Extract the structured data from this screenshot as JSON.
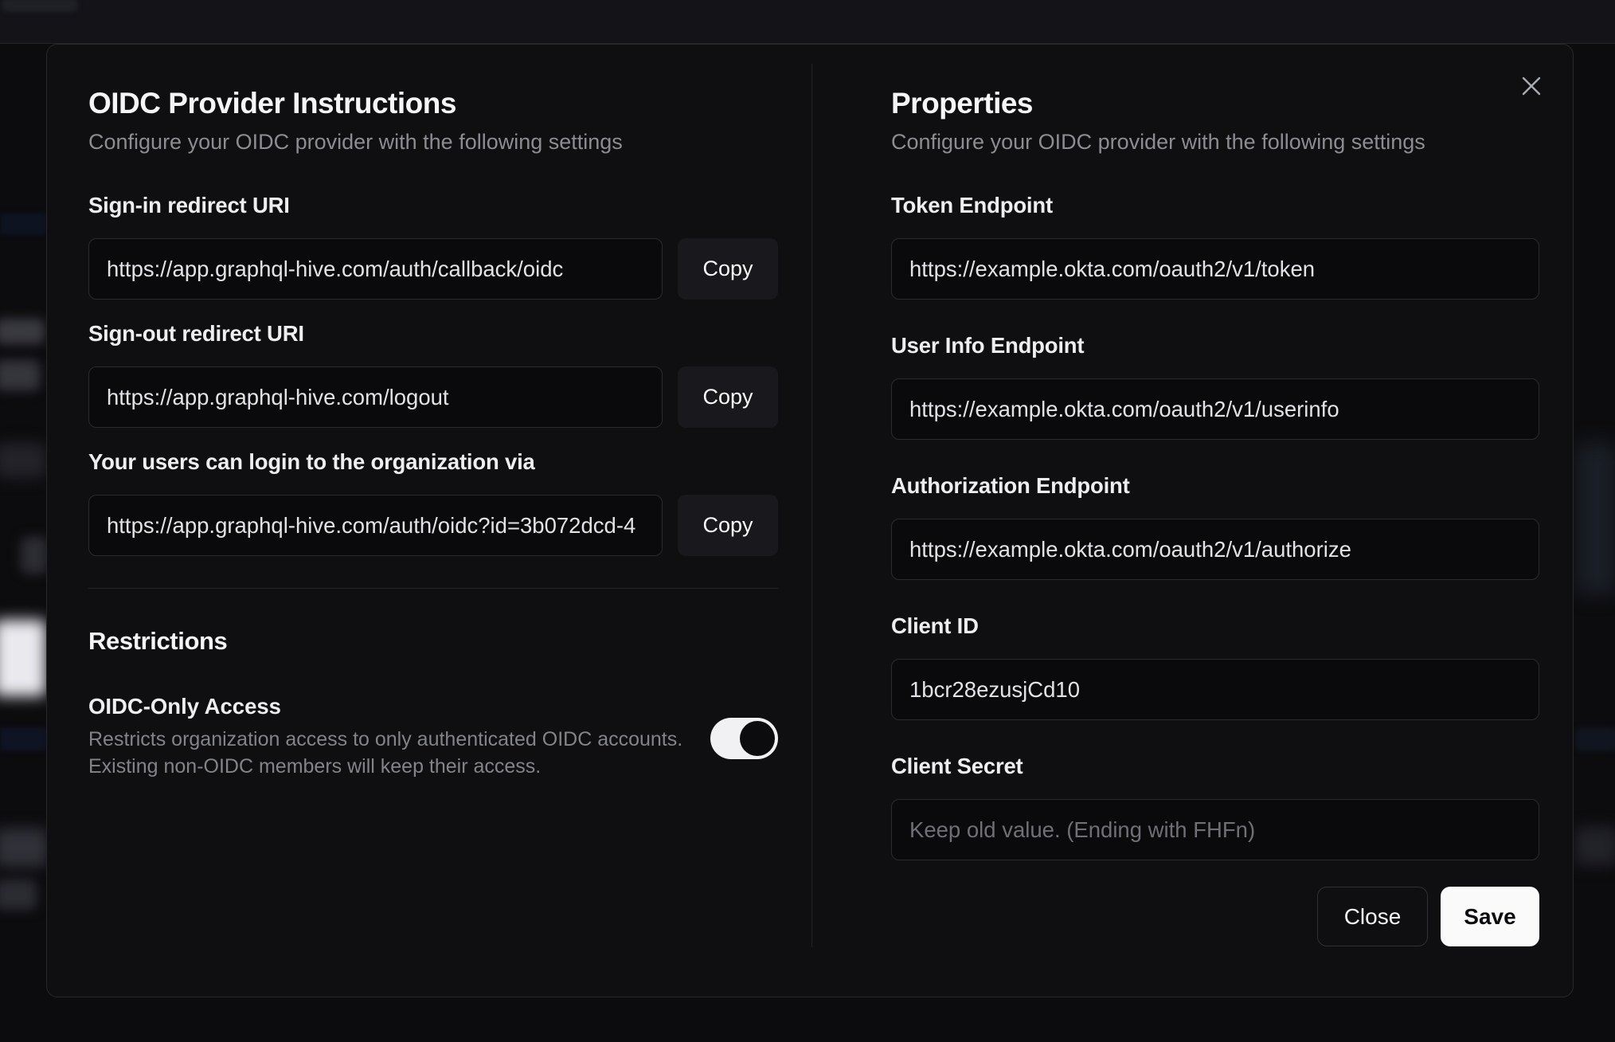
{
  "modal": {
    "left": {
      "title": "OIDC Provider Instructions",
      "subtitle": "Configure your OIDC provider with the following settings",
      "fields": [
        {
          "label": "Sign-in redirect URI",
          "value": "https://app.graphql-hive.com/auth/callback/oidc",
          "copy_label": "Copy"
        },
        {
          "label": "Sign-out redirect URI",
          "value": "https://app.graphql-hive.com/logout",
          "copy_label": "Copy"
        },
        {
          "label": "Your users can login to the organization via",
          "value": "https://app.graphql-hive.com/auth/oidc?id=3b072dcd-4",
          "copy_label": "Copy"
        }
      ],
      "restrictions": {
        "section_title": "Restrictions",
        "toggle_label": "OIDC-Only Access",
        "description_line1": "Restricts organization access to only authenticated OIDC accounts.",
        "description_line2": "Existing non-OIDC members will keep their access.",
        "toggle_state": "on"
      }
    },
    "right": {
      "title": "Properties",
      "subtitle": "Configure your OIDC provider with the following settings",
      "fields": [
        {
          "label": "Token Endpoint",
          "value": "https://example.okta.com/oauth2/v1/token"
        },
        {
          "label": "User Info Endpoint",
          "value": "https://example.okta.com/oauth2/v1/userinfo"
        },
        {
          "label": "Authorization Endpoint",
          "value": "https://example.okta.com/oauth2/v1/authorize"
        },
        {
          "label": "Client ID",
          "value": "1bcr28ezusjCd10"
        },
        {
          "label": "Client Secret",
          "value": "",
          "placeholder": "Keep old value. (Ending with FHFn)"
        }
      ],
      "close_label": "Close",
      "save_label": "Save"
    },
    "icons": {
      "close": "x-mark"
    },
    "colors": {
      "modal_bg": "#0f0f12",
      "save_button_bg": "#fafafa",
      "toggle_on_track": "#f1f1f3",
      "toggle_on_knob": "#0c0c0f"
    }
  }
}
